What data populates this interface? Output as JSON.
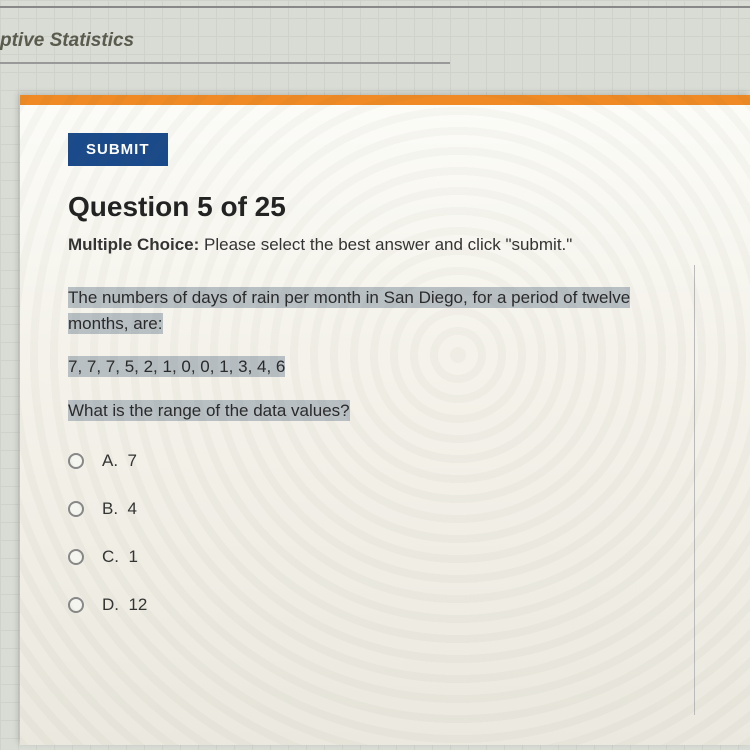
{
  "header": {
    "title_fragment": "ptive Statistics"
  },
  "toolbar": {
    "submit_label": "SUBMIT"
  },
  "question": {
    "heading": "Question 5 of 25",
    "type_label": "Multiple Choice:",
    "instruction": " Please select the best answer and click \"submit.\"",
    "prompt_line1": "The numbers of days of rain per month in San Diego, for a period of twelve months, are:",
    "data_values": "7, 7, 7, 5, 2, 1, 0, 0, 1, 3, 4, 6",
    "prompt_line2": "What is the range of the data values?"
  },
  "options": [
    {
      "letter": "A.",
      "text": "7"
    },
    {
      "letter": "B.",
      "text": "4"
    },
    {
      "letter": "C.",
      "text": "1"
    },
    {
      "letter": "D.",
      "text": "12"
    }
  ]
}
